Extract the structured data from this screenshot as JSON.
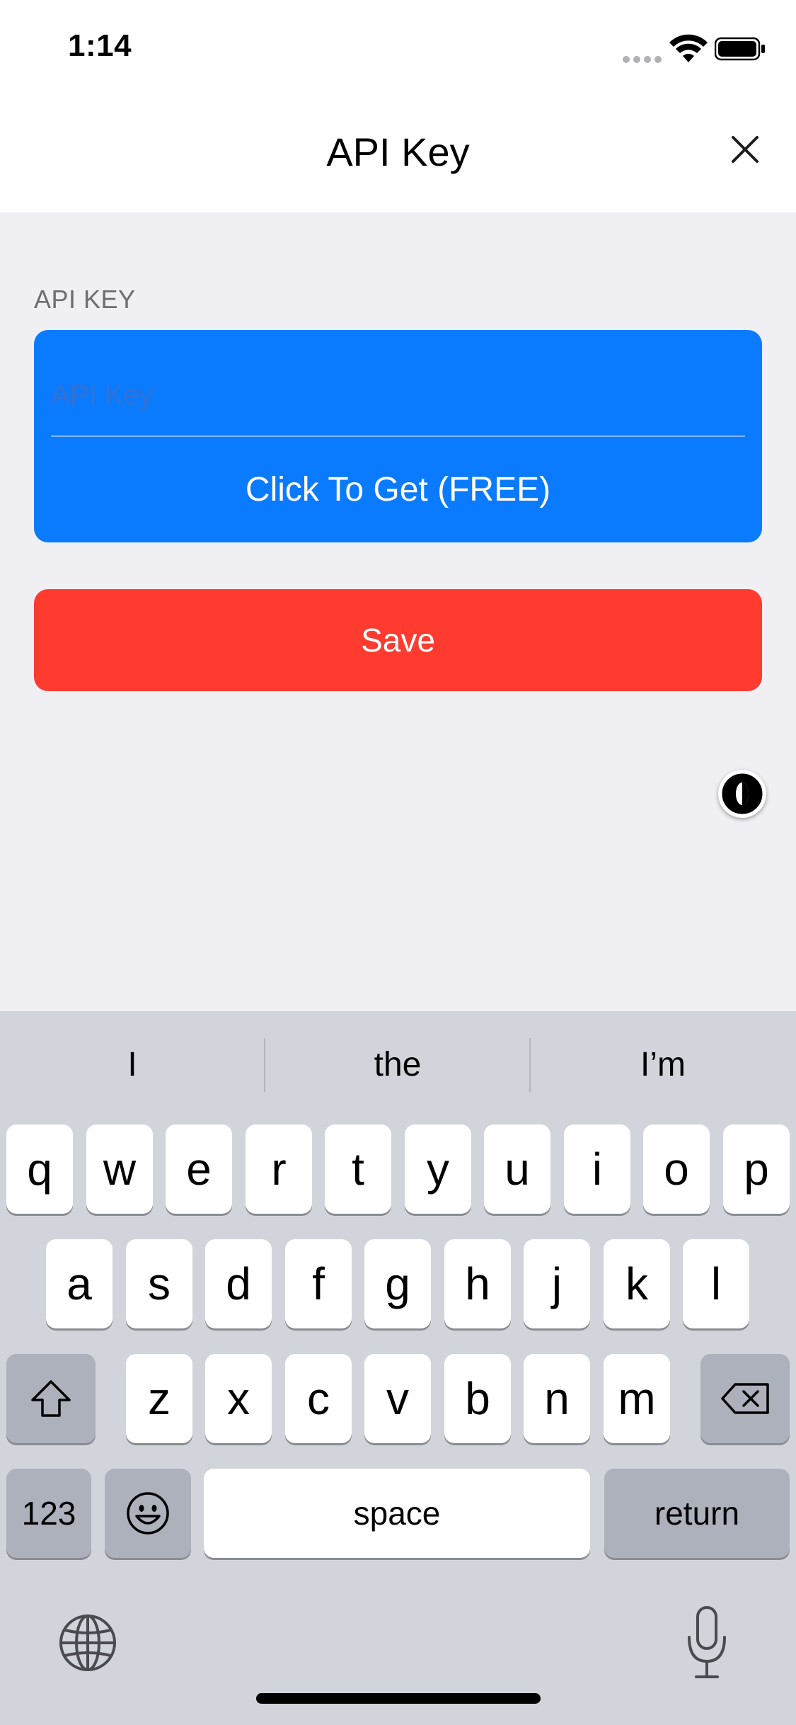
{
  "status_bar": {
    "time": "1:14"
  },
  "nav": {
    "title": "API Key",
    "close_icon": "close-icon"
  },
  "form": {
    "section_header": "API KEY",
    "api_key": {
      "value": "",
      "placeholder": "API Key"
    },
    "get_button_label": "Click To Get (FREE)",
    "save_button_label": "Save"
  },
  "colors": {
    "primary_blue": "#0a7bff",
    "save_red": "#ff3b30",
    "background": "#efeff4",
    "keyboard_bg": "#d1d4db"
  },
  "keyboard": {
    "suggestions": [
      "I",
      "the",
      "I’m"
    ],
    "row1": [
      "q",
      "w",
      "e",
      "r",
      "t",
      "y",
      "u",
      "i",
      "o",
      "p"
    ],
    "row2": [
      "a",
      "s",
      "d",
      "f",
      "g",
      "h",
      "j",
      "k",
      "l"
    ],
    "row3": [
      "z",
      "x",
      "c",
      "v",
      "b",
      "n",
      "m"
    ],
    "numbers_label": "123",
    "space_label": "space",
    "return_label": "return",
    "icons": [
      "shift-icon",
      "backspace-icon",
      "emoji-icon",
      "globe-icon",
      "microphone-icon"
    ]
  }
}
